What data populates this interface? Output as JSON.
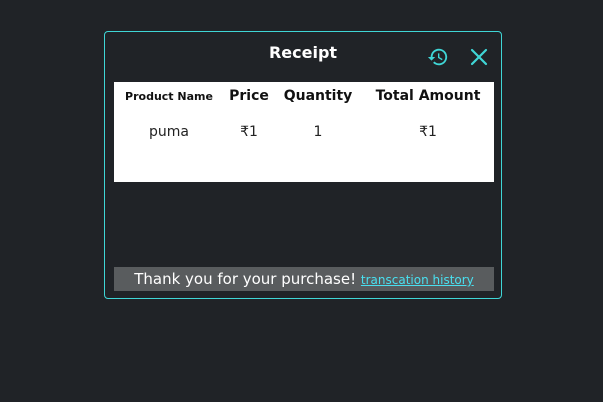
{
  "receipt": {
    "title": "Receipt",
    "icons": {
      "history": "history-icon",
      "close": "close-icon"
    },
    "accent_color": "#3fd6d6",
    "table": {
      "headers": [
        "Product Name",
        "Price",
        "Quantity",
        "Total Amount"
      ],
      "rows": [
        [
          "puma",
          "₹1",
          "1",
          "₹1"
        ]
      ]
    },
    "footer": {
      "message": "Thank you for your purchase!",
      "link_label": "transcation history"
    }
  }
}
